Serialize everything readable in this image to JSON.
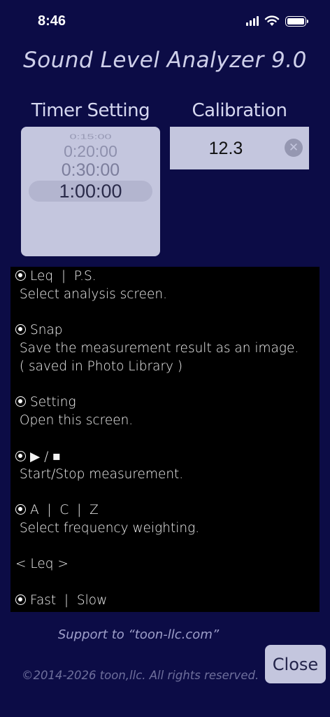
{
  "status_bar": {
    "time": "8:46"
  },
  "app": {
    "title": "Sound Level Analyzer 9.0"
  },
  "timer": {
    "label": "Timer Setting",
    "options": [
      "0:15:00",
      "0:20:00",
      "0:30:00",
      "1:00:00"
    ],
    "selected": "1:00:00"
  },
  "calibration": {
    "label": "Calibration",
    "value": "12.3"
  },
  "help": {
    "lines": [
      {
        "bullet": true,
        "text": "Leq  |  P.S."
      },
      {
        "bullet": false,
        "text": " Select analysis screen."
      },
      {
        "bullet": true,
        "text": "Snap"
      },
      {
        "bullet": false,
        "text": " Save the measurement result as an image."
      },
      {
        "bullet": false,
        "text": " ( saved in Photo Library )"
      },
      {
        "bullet": true,
        "text": "Setting"
      },
      {
        "bullet": false,
        "text": " Open this screen."
      },
      {
        "bullet": true,
        "text": "▶ / ■"
      },
      {
        "bullet": false,
        "text": " Start/Stop measurement."
      },
      {
        "bullet": true,
        "text": "A  |  C  |  Z"
      },
      {
        "bullet": false,
        "text": " Select frequency weighting."
      },
      {
        "bullet": false,
        "text": "< Leq >"
      },
      {
        "bullet": true,
        "text": "Fast  |  Slow"
      }
    ]
  },
  "footer": {
    "support": "Support to “toon-llc.com”",
    "copyright": "©2014-2026 toon,llc. All rights reserved.",
    "close_label": "Close"
  }
}
